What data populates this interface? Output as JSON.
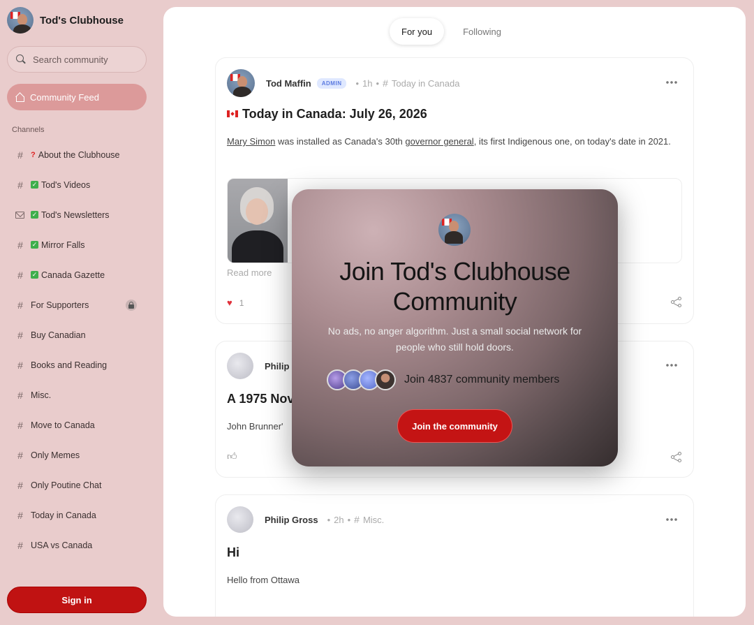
{
  "brand": {
    "name": "Tod's Clubhouse"
  },
  "search": {
    "placeholder": "Search community"
  },
  "nav": {
    "feed_label": "Community Feed",
    "channels_heading": "Channels"
  },
  "channels": [
    {
      "label": "About the Clubhouse",
      "icon": "hash",
      "emoji": "?"
    },
    {
      "label": "Tod's Videos",
      "icon": "hash",
      "emoji": "check"
    },
    {
      "label": "Tod's Newsletters",
      "icon": "mail",
      "emoji": "check"
    },
    {
      "label": "Mirror Falls",
      "icon": "hash",
      "emoji": "check"
    },
    {
      "label": "Canada Gazette",
      "icon": "hash",
      "emoji": "check"
    },
    {
      "label": "For Supporters",
      "icon": "hash",
      "locked": true
    },
    {
      "label": "Buy Canadian",
      "icon": "hash"
    },
    {
      "label": "Books and Reading",
      "icon": "hash"
    },
    {
      "label": "Misc.",
      "icon": "hash"
    },
    {
      "label": "Move to Canada",
      "icon": "hash"
    },
    {
      "label": "Only Memes",
      "icon": "hash"
    },
    {
      "label": "Only Poutine Chat",
      "icon": "hash"
    },
    {
      "label": "Today in Canada",
      "icon": "hash"
    },
    {
      "label": "USA vs Canada",
      "icon": "hash"
    }
  ],
  "signin_label": "Sign in",
  "tabs": [
    {
      "label": "For you",
      "active": true
    },
    {
      "label": "Following",
      "active": false
    }
  ],
  "posts": [
    {
      "author": "Tod Maffin",
      "badge": "ADMIN",
      "time": "1h",
      "channel": "Today in Canada",
      "title": "Today in Canada: July 26, 2026",
      "body_link1": "Mary Simon",
      "body_mid": " was installed as Canada's 30th ",
      "body_link2": "governor general",
      "body_end": ", its first Indigenous one, on today's date in 2021.",
      "read_more": "Read more",
      "likes": "1"
    },
    {
      "author": "Philip",
      "title": "A 1975 Nov",
      "snippet": "John Brunner'"
    },
    {
      "author": "Philip Gross",
      "time": "2h",
      "channel": "Misc.",
      "title": "Hi",
      "snippet": "Hello from Ottawa"
    }
  ],
  "modal": {
    "title": "Join Tod's Clubhouse Community",
    "description": "No ads, no anger algorithm. Just a small social network for people who still hold doors.",
    "members_text": "Join 4837 community members",
    "cta_label": "Join the community"
  },
  "colors": {
    "accent": "#c41414",
    "sidebar_bg": "#e9cccc",
    "feed_active": "#dc9a9a"
  }
}
